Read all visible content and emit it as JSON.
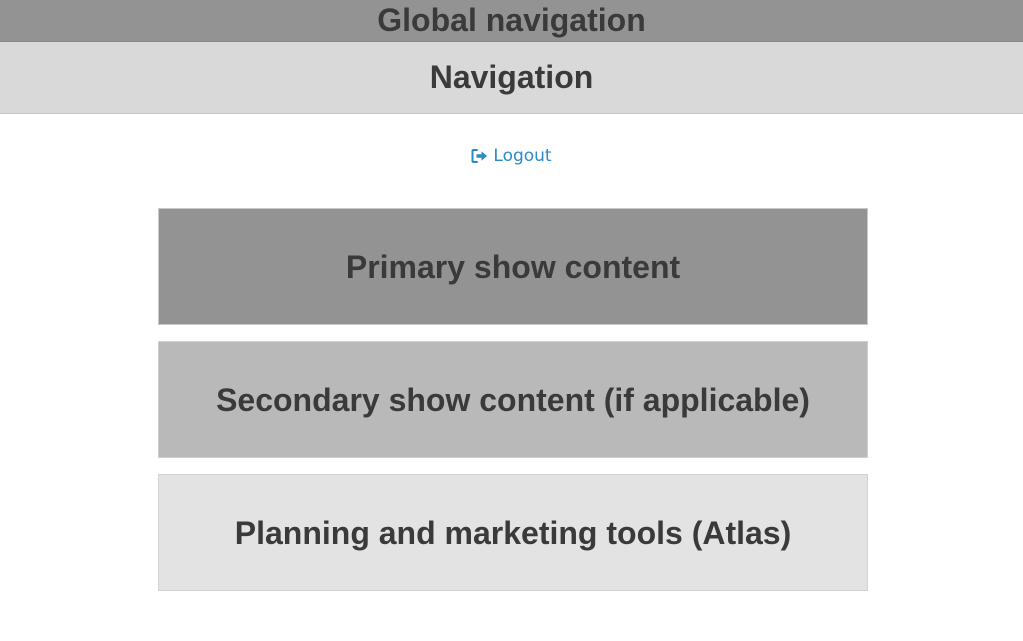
{
  "global_navigation": {
    "title": "Global navigation"
  },
  "navigation": {
    "title": "Navigation"
  },
  "account": {
    "logout_label": "Logout",
    "logout_icon": "sign-out-icon",
    "link_color": "#2a8bc7"
  },
  "content_blocks": [
    {
      "label": "Primary show content",
      "background": "#939393"
    },
    {
      "label": "Secondary show content (if applicable)",
      "background": "#b9b9b9"
    },
    {
      "label": "Planning and marketing tools (Atlas)",
      "background": "#e3e3e3"
    }
  ]
}
